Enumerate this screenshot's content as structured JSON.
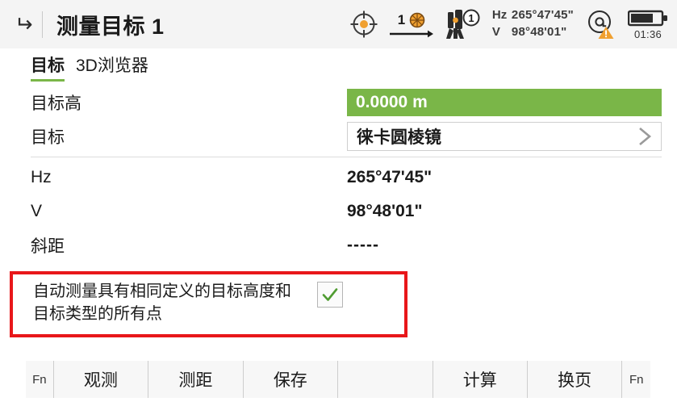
{
  "titlebar": {
    "back_icon": "back-arrow-icon",
    "title": "测量目标 1"
  },
  "status": {
    "target_icon": "crosshair-target-icon",
    "prism_number": "1",
    "prism_icon": "prism-icon",
    "arrow_icon": "arrow-right-icon",
    "station_icon": "total-station-icon",
    "station_number": "1",
    "hz_label": "Hz",
    "hz_value": "265°47'45\"",
    "v_label": "V",
    "v_value": "98°48'01\"",
    "atr_icon": "at-warning-icon",
    "battery_icon": "battery-icon",
    "battery_time": "01:36"
  },
  "tabs": [
    {
      "label": "目标",
      "active": true
    },
    {
      "label": "3D浏览器",
      "active": false
    }
  ],
  "form": {
    "rows": [
      {
        "label": "目标高",
        "value": "0.0000 m",
        "style": "green"
      },
      {
        "label": "目标",
        "value": "徕卡圆棱镜",
        "style": "select"
      },
      {
        "label": "Hz",
        "value": "265°47'45\"",
        "style": "plain"
      },
      {
        "label": "V",
        "value": "98°48'01\"",
        "style": "plain"
      },
      {
        "label": "斜距",
        "value": "-----",
        "style": "plain"
      }
    ]
  },
  "highlight": {
    "text": "自动测量具有相同定义的目标高度和目标类型的所有点",
    "checked": true,
    "check_icon": "check-icon",
    "border_color": "#e8171a"
  },
  "toolbar": {
    "fn_left": "Fn",
    "buttons": [
      "观测",
      "测距",
      "保存"
    ],
    "blank": "",
    "buttons_right": [
      "计算",
      "换页"
    ],
    "fn_right": "Fn"
  },
  "colors": {
    "accent_green": "#7ab648",
    "highlight_red": "#e8171a",
    "warning_orange": "#f0a030"
  }
}
